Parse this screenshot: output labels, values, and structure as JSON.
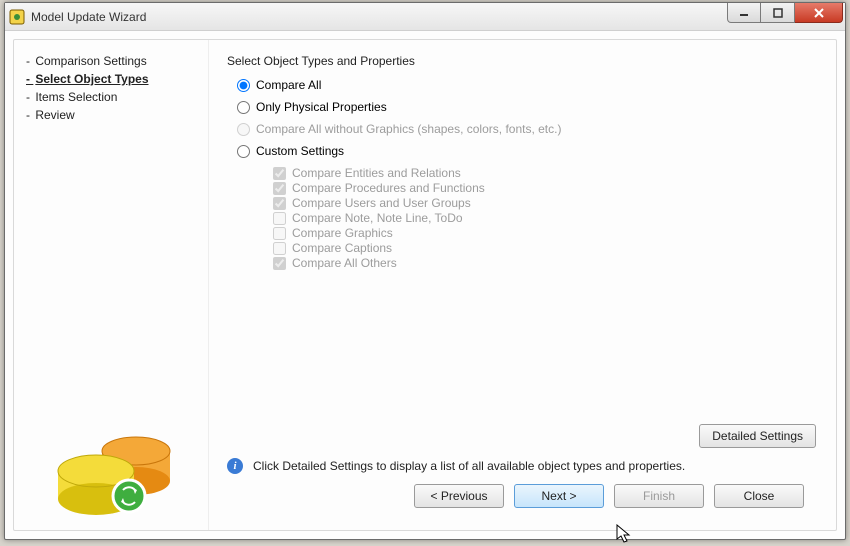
{
  "window": {
    "title": "Model Update Wizard"
  },
  "sidebar": {
    "items": [
      {
        "label": "Comparison Settings",
        "current": false
      },
      {
        "label": "Select Object Types",
        "current": true
      },
      {
        "label": "Items Selection",
        "current": false
      },
      {
        "label": "Review",
        "current": false
      }
    ]
  },
  "main": {
    "section_title": "Select Object Types and Properties",
    "options": {
      "compare_all": "Compare All",
      "only_physical": "Only Physical Properties",
      "compare_all_no_graphics": "Compare All without Graphics (shapes, colors, fonts, etc.)",
      "custom_settings": "Custom Settings"
    },
    "custom_checks": [
      {
        "label": "Compare Entities and Relations",
        "checked": true
      },
      {
        "label": "Compare Procedures and Functions",
        "checked": true
      },
      {
        "label": "Compare Users and User Groups",
        "checked": true
      },
      {
        "label": "Compare Note, Note Line, ToDo",
        "checked": false
      },
      {
        "label": "Compare Graphics",
        "checked": false
      },
      {
        "label": "Compare Captions",
        "checked": false
      },
      {
        "label": "Compare All Others",
        "checked": true
      }
    ],
    "detailed_settings_label": "Detailed Settings",
    "info_text": "Click Detailed Settings to display a list of all available object types and properties."
  },
  "footer": {
    "previous": "< Previous",
    "next": "Next >",
    "finish": "Finish",
    "close": "Close"
  }
}
